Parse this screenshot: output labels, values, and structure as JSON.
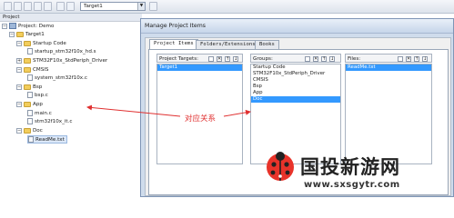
{
  "toolbar": {
    "target_select": "Target1"
  },
  "project_pane": {
    "title": "Project",
    "root": "Project: Demo",
    "target": "Target1",
    "groups": [
      {
        "name": "Startup Code",
        "files": [
          "startup_stm32f10x_hd.s"
        ]
      },
      {
        "name": "STM32F10x_StdPeriph_Driver",
        "files": []
      },
      {
        "name": "CMSIS",
        "files": [
          "system_stm32f10x.c"
        ]
      },
      {
        "name": "Bsp",
        "files": [
          "bsp.c"
        ]
      },
      {
        "name": "App",
        "files": [
          "main.c",
          "stm32f10x_it.c"
        ]
      },
      {
        "name": "Doc",
        "files": [
          "ReadMe.txt"
        ]
      }
    ]
  },
  "dialog": {
    "title": "Manage Project Items",
    "tabs": [
      "Project Items",
      "Folders/Extensions",
      "Books"
    ],
    "columns": {
      "targets": {
        "label": "Project Targets:",
        "items": [
          "Target1"
        ]
      },
      "groups": {
        "label": "Groups:",
        "items": [
          "Startup Code",
          "STM32F10x_StdPeriph_Driver",
          "CMSIS",
          "Bsp",
          "App",
          "Doc"
        ],
        "selected": 5
      },
      "files": {
        "label": "Files:",
        "items": [
          "ReadMe.txt"
        ]
      }
    }
  },
  "annotation": {
    "text": "对应关系",
    "color": "#e03030"
  },
  "watermark": {
    "name": "国投新游网",
    "url": "www.sxsgytr.com"
  }
}
